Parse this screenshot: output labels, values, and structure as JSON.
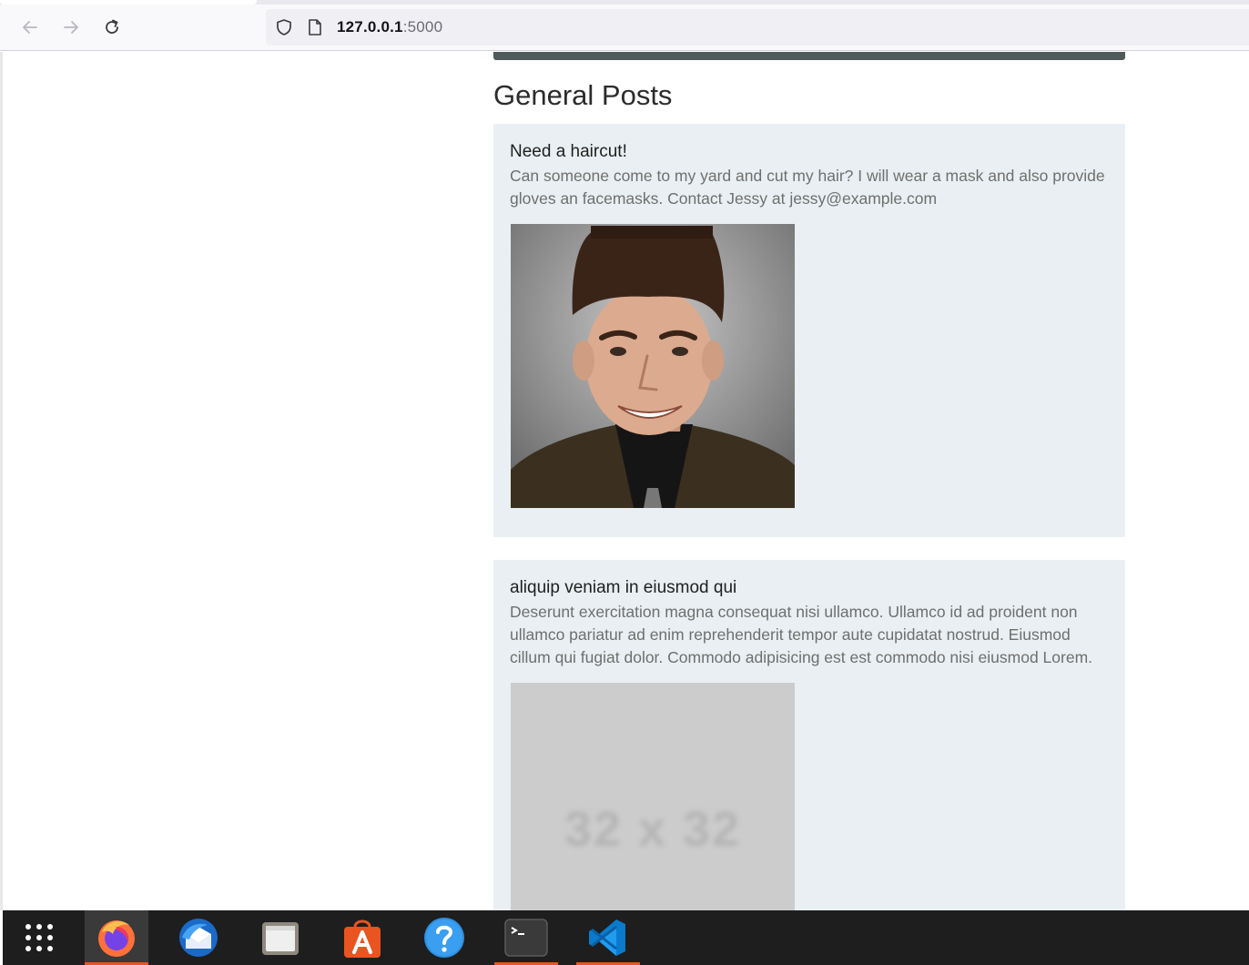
{
  "browser": {
    "url_host": "127.0.0.1",
    "url_port": ":5000",
    "icons": {
      "back": "back-arrow-icon",
      "forward": "forward-arrow-icon",
      "reload": "reload-icon",
      "tracking": "shield-icon",
      "page": "page-icon"
    }
  },
  "page": {
    "section_title": "General Posts",
    "posts": [
      {
        "title": "Need a haircut!",
        "body": "Can someone come to my yard and cut my hair? I will wear a mask and also provide gloves an facemasks. Contact Jessy at jessy@example.com",
        "image": "portrait-photo"
      },
      {
        "title": "aliquip veniam in eiusmod qui",
        "body": "Deserunt exercitation magna consequat nisi ullamco. Ullamco id ad proident non ullamco pariatur ad enim reprehenderit tempor aute cupidatat nostrud. Eiusmod cillum qui fugiat dolor. Commodo adipisicing est est commodo nisi eiusmod Lorem.",
        "image_placeholder_text": "32 x 32"
      }
    ]
  },
  "taskbar": {
    "items": [
      {
        "name": "app-grid-icon",
        "active": false,
        "running": false
      },
      {
        "name": "firefox-icon",
        "active": true,
        "running": true
      },
      {
        "name": "thunderbird-icon",
        "active": false,
        "running": false
      },
      {
        "name": "files-icon",
        "active": false,
        "running": false
      },
      {
        "name": "software-center-icon",
        "active": false,
        "running": false
      },
      {
        "name": "help-icon",
        "active": false,
        "running": false
      },
      {
        "name": "terminal-icon",
        "active": false,
        "running": true
      },
      {
        "name": "vscode-icon",
        "active": false,
        "running": true
      }
    ]
  },
  "colors": {
    "accent": "#e95420",
    "card_bg": "#e9eff2",
    "header_bar": "#4f5b5a",
    "taskbar_bg": "#1e1e1e"
  }
}
